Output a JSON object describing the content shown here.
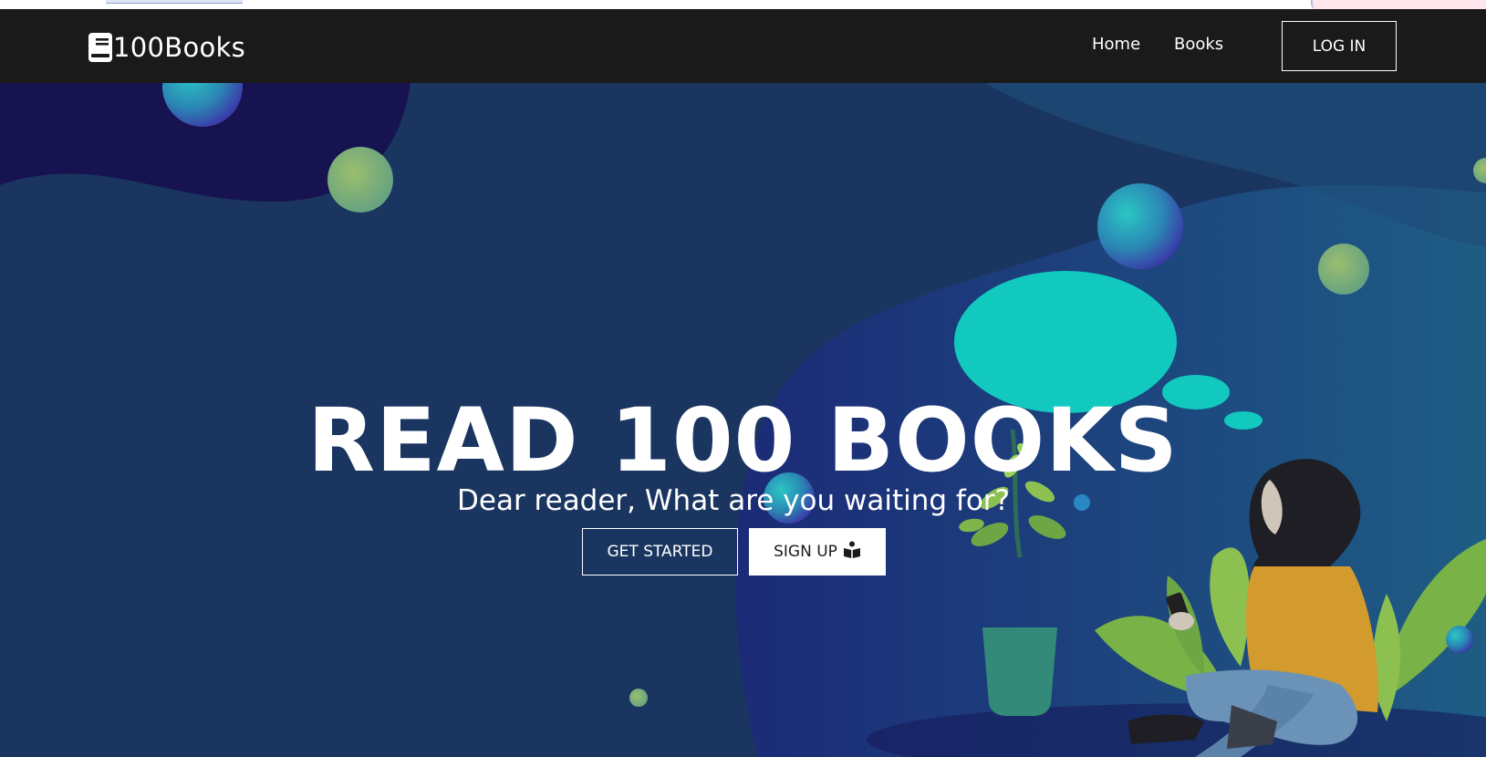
{
  "brand": {
    "name": "100Books",
    "icon": "book-icon"
  },
  "nav": {
    "links": [
      {
        "label": "Home"
      },
      {
        "label": "Books"
      }
    ],
    "login_label": "LOG IN"
  },
  "hero": {
    "title": "READ 100 BOOKS",
    "subtitle": "Dear reader, What are you waiting for?",
    "get_started_label": "GET STARTED",
    "signup_label": "SIGN UP",
    "signup_icon": "book-reader-icon"
  },
  "colors": {
    "navbar": "#1a1a1a",
    "hero_background": "#1a3560",
    "accent_teal": "#12c9c0",
    "blob_dark": "#1a1550"
  }
}
